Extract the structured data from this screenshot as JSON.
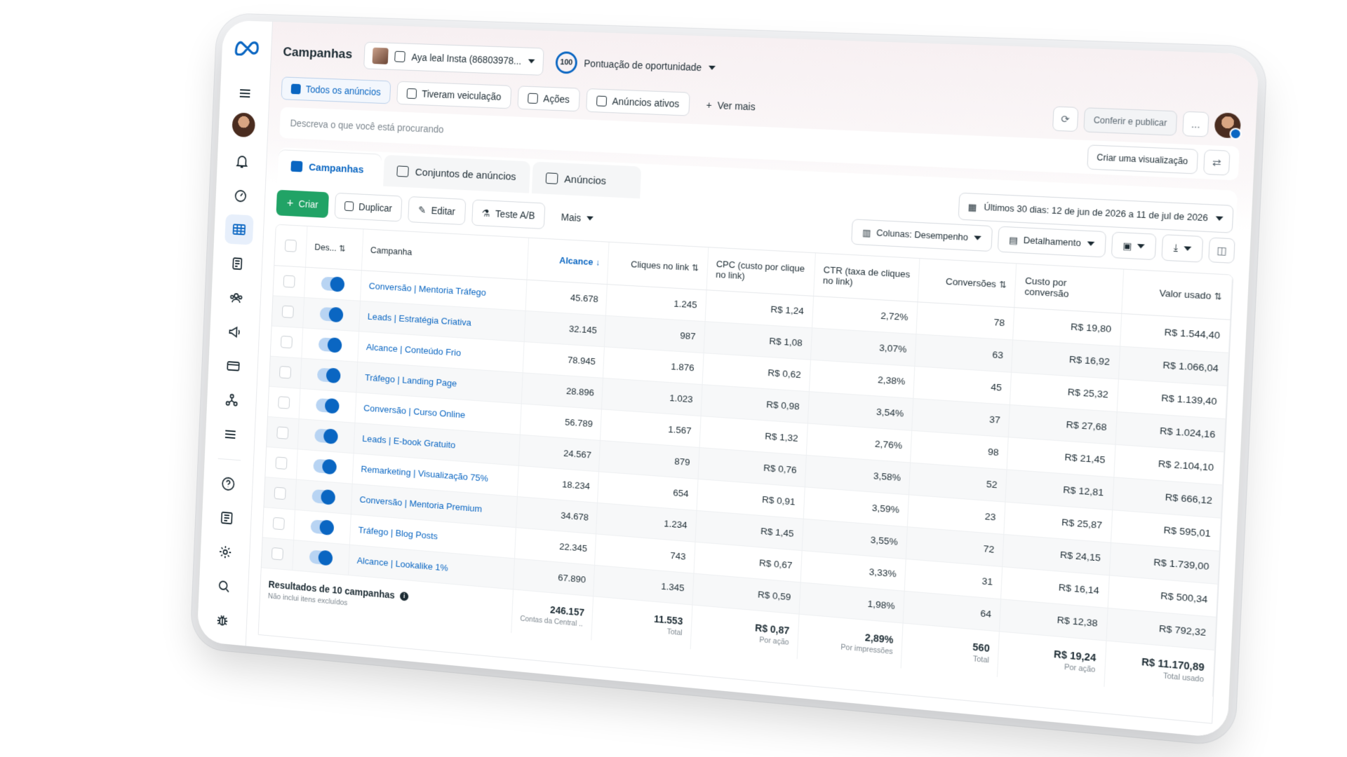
{
  "header": {
    "title": "Campanhas",
    "account": "Aya leal Insta (86803978...",
    "score_value": "100",
    "score_label": "Pontuação de oportunidade"
  },
  "filters": {
    "tabs": [
      "Todos os anúncios",
      "Tiveram veiculação",
      "Ações",
      "Anúncios ativos"
    ],
    "more": "Ver mais",
    "review_publish": "Conferir e publicar",
    "more_menu": "..."
  },
  "search": {
    "placeholder": "Descreva o que você está procurando",
    "create_view": "Criar uma visualização"
  },
  "levels": {
    "campaigns": "Campanhas",
    "adsets": "Conjuntos de anúncios",
    "ads": "Anúncios"
  },
  "date_range": "Últimos 30 dias: 12 de jun de 2026 a 11 de jul de 2026",
  "toolbar": {
    "create": "Criar",
    "duplicate": "Duplicar",
    "edit": "Editar",
    "ab_test": "Teste A/B",
    "more": "Mais",
    "columns": "Colunas: Desempenho",
    "breakdown": "Detalhamento"
  },
  "columns": {
    "delivery": "Des...",
    "campaign": "Campanha",
    "reach": "Alcance",
    "link_clicks": "Cliques no link",
    "cpc": "CPC (custo por clique no link)",
    "ctr": "CTR (taxa de cliques no link)",
    "conversions": "Conversões",
    "cost_per_conv": "Custo por conversão",
    "spent": "Valor usado"
  },
  "rows": [
    {
      "name": "Conversão | Mentoria Tráfego",
      "reach": "45.678",
      "clicks": "1.245",
      "cpc": "R$ 1,24",
      "ctr": "2,72%",
      "conv": "78",
      "cpconv": "R$ 19,80",
      "spent": "R$ 1.544,40"
    },
    {
      "name": "Leads | Estratégia Criativa",
      "reach": "32.145",
      "clicks": "987",
      "cpc": "R$ 1,08",
      "ctr": "3,07%",
      "conv": "63",
      "cpconv": "R$ 16,92",
      "spent": "R$ 1.066,04"
    },
    {
      "name": "Alcance | Conteúdo Frio",
      "reach": "78.945",
      "clicks": "1.876",
      "cpc": "R$ 0,62",
      "ctr": "2,38%",
      "conv": "45",
      "cpconv": "R$ 25,32",
      "spent": "R$ 1.139,40"
    },
    {
      "name": "Tráfego | Landing Page",
      "reach": "28.896",
      "clicks": "1.023",
      "cpc": "R$ 0,98",
      "ctr": "3,54%",
      "conv": "37",
      "cpconv": "R$ 27,68",
      "spent": "R$ 1.024,16"
    },
    {
      "name": "Conversão | Curso Online",
      "reach": "56.789",
      "clicks": "1.567",
      "cpc": "R$ 1,32",
      "ctr": "2,76%",
      "conv": "98",
      "cpconv": "R$ 21,45",
      "spent": "R$ 2.104,10"
    },
    {
      "name": "Leads | E-book Gratuito",
      "reach": "24.567",
      "clicks": "879",
      "cpc": "R$ 0,76",
      "ctr": "3,58%",
      "conv": "52",
      "cpconv": "R$ 12,81",
      "spent": "R$ 666,12"
    },
    {
      "name": "Remarketing | Visualização 75%",
      "reach": "18.234",
      "clicks": "654",
      "cpc": "R$ 0,91",
      "ctr": "3,59%",
      "conv": "23",
      "cpconv": "R$ 25,87",
      "spent": "R$ 595,01"
    },
    {
      "name": "Conversão | Mentoria Premium",
      "reach": "34.678",
      "clicks": "1.234",
      "cpc": "R$ 1,45",
      "ctr": "3,55%",
      "conv": "72",
      "cpconv": "R$ 24,15",
      "spent": "R$ 1.739,00"
    },
    {
      "name": "Tráfego | Blog Posts",
      "reach": "22.345",
      "clicks": "743",
      "cpc": "R$ 0,67",
      "ctr": "3,33%",
      "conv": "31",
      "cpconv": "R$ 16,14",
      "spent": "R$ 500,34"
    },
    {
      "name": "Alcance | Lookalike 1%",
      "reach": "67.890",
      "clicks": "1.345",
      "cpc": "R$ 0,59",
      "ctr": "1,98%",
      "conv": "64",
      "cpconv": "R$ 12,38",
      "spent": "R$ 792,32"
    }
  ],
  "totals": {
    "title": "Resultados de 10 campanhas",
    "subtitle": "Não inclui itens excluídos",
    "reach": "246.157",
    "reach_sub": "Contas da Central ...",
    "clicks": "11.553",
    "clicks_sub": "Total",
    "cpc": "R$ 0,87",
    "cpc_sub": "Por ação",
    "ctr": "2,89%",
    "ctr_sub": "Por impressões",
    "conv": "560",
    "conv_sub": "Total",
    "cpconv": "R$ 19,24",
    "cpconv_sub": "Por ação",
    "spent": "R$ 11.170,89",
    "spent_sub": "Total usado"
  },
  "colors": {
    "accent": "#0a66c2",
    "create": "#21a366"
  }
}
